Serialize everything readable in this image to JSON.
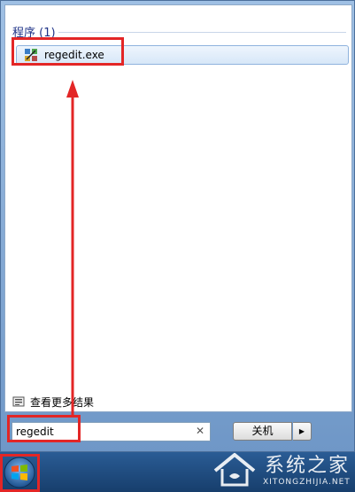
{
  "results": {
    "section_title": "程序 (1)",
    "items": [
      {
        "label": "regedit.exe",
        "icon": "regedit-icon"
      }
    ]
  },
  "see_more": {
    "label": "查看更多结果",
    "icon": "search-results-icon"
  },
  "search": {
    "value": "regedit",
    "clear_icon": "clear-icon"
  },
  "shutdown": {
    "label": "关机",
    "arrow_icon": "triangle-right-icon"
  },
  "taskbar": {
    "start_icon": "windows-orb-icon"
  },
  "watermark": {
    "cn_text": "系统之家",
    "en_text": "XITONGZHIJIA.NET"
  },
  "colors": {
    "annotation": "#e32626",
    "section_title": "#1e3287",
    "highlight": "#d7e7f8"
  }
}
